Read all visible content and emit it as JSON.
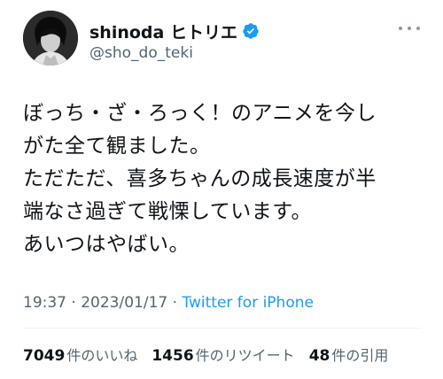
{
  "colors": {
    "verified_badge": "#1d9bf0",
    "link": "#1d9bf0",
    "secondary_text": "#536471",
    "primary_text": "#0f1419"
  },
  "user": {
    "display_name": "shinoda ヒトリエ",
    "handle": "@sho_do_teki",
    "verified": true
  },
  "tweet": {
    "lines": [
      "ぼっち・ざ・ろっく！のアニメを今し",
      "がた全て観ました。",
      "ただただ、喜多ちゃんの成長速度が半",
      "端なさ過ぎて戦慄しています。",
      "あいつはやばい。"
    ],
    "time": "19:37",
    "separator_1": "·",
    "date": "2023/01/17",
    "separator_2": "·",
    "source": "Twitter for iPhone"
  },
  "stats": {
    "likes_count": "7049",
    "likes_label": "件のいいね",
    "retweets_count": "1456",
    "retweets_label": "件のリツイート",
    "quotes_count": "48",
    "quotes_label": "件の引用"
  },
  "icons": {
    "verified": "verified-badge-icon",
    "more": "more-options-icon"
  }
}
